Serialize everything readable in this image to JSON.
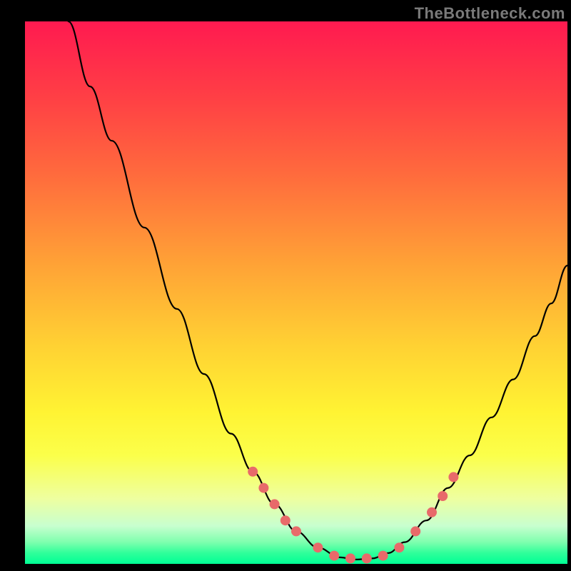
{
  "watermark": "TheBottleneck.com",
  "chart_data": {
    "type": "line",
    "title": "",
    "xlabel": "",
    "ylabel": "",
    "xlim": [
      0,
      100
    ],
    "ylim": [
      0,
      100
    ],
    "legend": false,
    "grid": false,
    "series": [
      {
        "name": "curve",
        "color": "#000000",
        "points": [
          {
            "x": 8,
            "y": 100
          },
          {
            "x": 12,
            "y": 88
          },
          {
            "x": 16,
            "y": 78
          },
          {
            "x": 22,
            "y": 62
          },
          {
            "x": 28,
            "y": 47
          },
          {
            "x": 33,
            "y": 35
          },
          {
            "x": 38,
            "y": 24
          },
          {
            "x": 42,
            "y": 17
          },
          {
            "x": 46,
            "y": 11
          },
          {
            "x": 50,
            "y": 6
          },
          {
            "x": 54,
            "y": 3
          },
          {
            "x": 58,
            "y": 1.2
          },
          {
            "x": 61,
            "y": 0.8
          },
          {
            "x": 64,
            "y": 1
          },
          {
            "x": 67,
            "y": 2
          },
          {
            "x": 70,
            "y": 4
          },
          {
            "x": 74,
            "y": 8
          },
          {
            "x": 78,
            "y": 14
          },
          {
            "x": 82,
            "y": 20
          },
          {
            "x": 86,
            "y": 27
          },
          {
            "x": 90,
            "y": 34
          },
          {
            "x": 94,
            "y": 42
          },
          {
            "x": 97,
            "y": 48
          },
          {
            "x": 100,
            "y": 55
          }
        ]
      }
    ],
    "markers": {
      "name": "dots",
      "color": "#e86a6a",
      "radius_px": 7,
      "points": [
        {
          "x": 42,
          "y": 17
        },
        {
          "x": 44,
          "y": 14
        },
        {
          "x": 46,
          "y": 11
        },
        {
          "x": 48,
          "y": 8
        },
        {
          "x": 50,
          "y": 6
        },
        {
          "x": 54,
          "y": 3
        },
        {
          "x": 57,
          "y": 1.5
        },
        {
          "x": 60,
          "y": 1
        },
        {
          "x": 63,
          "y": 1
        },
        {
          "x": 66,
          "y": 1.5
        },
        {
          "x": 69,
          "y": 3
        },
        {
          "x": 72,
          "y": 6
        },
        {
          "x": 75,
          "y": 9.5
        },
        {
          "x": 77,
          "y": 12.5
        },
        {
          "x": 79,
          "y": 16
        }
      ]
    }
  }
}
